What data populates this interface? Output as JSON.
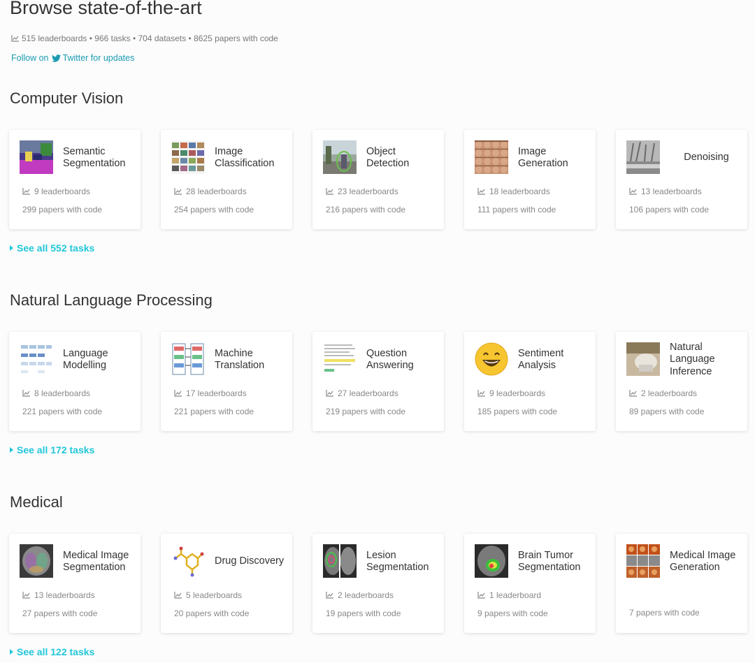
{
  "header": {
    "title": "Browse state-of-the-art",
    "stats": "515 leaderboards • 966 tasks • 704 datasets • 8625 papers with code",
    "follow_prefix": "Follow on",
    "follow_suffix": "Twitter for updates"
  },
  "sections": [
    {
      "title": "Computer Vision",
      "see_all": "See all 552 tasks",
      "cards": [
        {
          "name": "Semantic Segmentation",
          "leaderboards": "9 leaderboards",
          "papers": "299 papers with code",
          "icon": "segmentation-thumbnail"
        },
        {
          "name": "Image Classification",
          "leaderboards": "28 leaderboards",
          "papers": "254 papers with code",
          "icon": "image-grid-thumbnail"
        },
        {
          "name": "Object Detection",
          "leaderboards": "23 leaderboards",
          "papers": "216 papers with code",
          "icon": "street-scene-thumbnail"
        },
        {
          "name": "Image Generation",
          "leaderboards": "18 leaderboards",
          "papers": "111 papers with code",
          "icon": "faces-grid-thumbnail"
        },
        {
          "name": "Denoising",
          "leaderboards": "13 leaderboards",
          "papers": "106 papers with code",
          "icon": "noisy-photo-thumbnail"
        }
      ]
    },
    {
      "title": "Natural Language Processing",
      "see_all": "See all 172 tasks",
      "cards": [
        {
          "name": "Language Modelling",
          "leaderboards": "8 leaderboards",
          "papers": "221 papers with code",
          "icon": "token-diagram-thumbnail"
        },
        {
          "name": "Machine Translation",
          "leaderboards": "17 leaderboards",
          "papers": "221 papers with code",
          "icon": "translation-diagram-thumbnail"
        },
        {
          "name": "Question Answering",
          "leaderboards": "27 leaderboards",
          "papers": "219 papers with code",
          "icon": "text-passage-thumbnail"
        },
        {
          "name": "Sentiment Analysis",
          "leaderboards": "9 leaderboards",
          "papers": "185 papers with code",
          "icon": "smiley-face-thumbnail"
        },
        {
          "name": "Natural Language Inference",
          "leaderboards": "2 leaderboards",
          "papers": "89 papers with code",
          "icon": "photo-thumbnail"
        }
      ]
    },
    {
      "title": "Medical",
      "see_all": "See all 122 tasks",
      "cards": [
        {
          "name": "Medical Image Segmentation",
          "leaderboards": "13 leaderboards",
          "papers": "27 papers with code",
          "icon": "brain-scan-thumbnail"
        },
        {
          "name": "Drug Discovery",
          "leaderboards": "5 leaderboards",
          "papers": "20 papers with code",
          "icon": "molecule-thumbnail"
        },
        {
          "name": "Lesion Segmentation",
          "leaderboards": "2 leaderboards",
          "papers": "19 papers with code",
          "icon": "lesion-scan-thumbnail"
        },
        {
          "name": "Brain Tumor Segmentation",
          "leaderboards": "1 leaderboard",
          "papers": "9 papers with code",
          "icon": "tumor-scan-thumbnail"
        },
        {
          "name": "Medical Image Generation",
          "leaderboards": "",
          "papers": "7 papers with code",
          "icon": "scan-grid-thumbnail"
        }
      ]
    }
  ]
}
